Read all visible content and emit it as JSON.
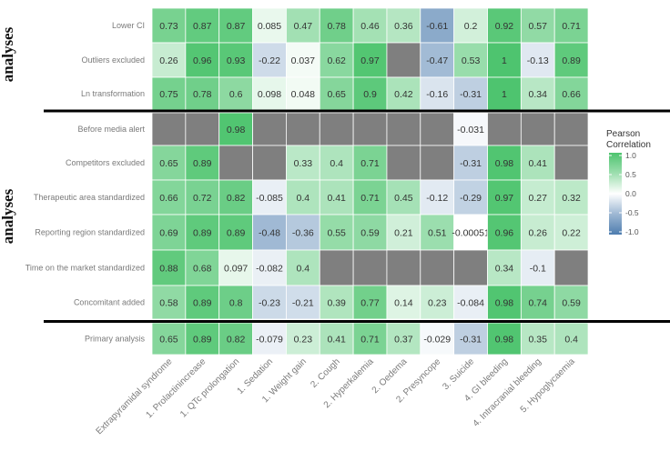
{
  "chart_data": {
    "type": "heatmap",
    "title": "",
    "xlabel": "",
    "ylabel": "",
    "group_labels": [
      "analyses",
      "analyses"
    ],
    "columns": [
      "Extrapyramidal syndrome",
      "1. Prolactinincrease",
      "1. QTc prolongation",
      "1. Sedation",
      "1. Weight gain",
      "2. Cough",
      "2. Hyperkalemia",
      "2. Oedema",
      "2. Presyncope",
      "3. Suicide",
      "4. GI bleeding",
      "4. Intracranial bleeding",
      "5. Hypoglycaemia"
    ],
    "rows": [
      {
        "label": "Lower CI",
        "group": 0,
        "values": [
          "0.73",
          "0.87",
          "0.87",
          "0.085",
          "0.47",
          "0.78",
          "0.46",
          "0.36",
          "-0.61",
          "0.2",
          "0.92",
          "0.57",
          "0.71"
        ]
      },
      {
        "label": "Outliers excluded",
        "group": 0,
        "values": [
          "0.26",
          "0.96",
          "0.93",
          "-0.22",
          "0.037",
          "0.62",
          "0.97",
          null,
          "-0.47",
          "0.53",
          "1",
          "-0.13",
          "0.89"
        ]
      },
      {
        "label": "Ln transformation",
        "group": 0,
        "values": [
          "0.75",
          "0.78",
          "0.6",
          "0.098",
          "0.048",
          "0.65",
          "0.9",
          "0.42",
          "-0.16",
          "-0.31",
          "1",
          "0.34",
          "0.66"
        ]
      },
      {
        "label": "Before media alert",
        "group": 1,
        "values": [
          null,
          null,
          "0.98",
          null,
          null,
          null,
          null,
          null,
          null,
          "-0.031",
          null,
          null,
          null
        ]
      },
      {
        "label": "Competitors excluded",
        "group": 1,
        "values": [
          "0.65",
          "0.89",
          null,
          null,
          "0.33",
          "0.4",
          "0.71",
          null,
          null,
          "-0.31",
          "0.98",
          "0.41",
          null
        ]
      },
      {
        "label": "Therapeutic area standardized",
        "group": 1,
        "values": [
          "0.66",
          "0.72",
          "0.82",
          "-0.085",
          "0.4",
          "0.41",
          "0.71",
          "0.45",
          "-0.12",
          "-0.29",
          "0.97",
          "0.27",
          "0.32"
        ]
      },
      {
        "label": "Reporting region standardized",
        "group": 1,
        "values": [
          "0.69",
          "0.89",
          "0.89",
          "-0.48",
          "-0.36",
          "0.55",
          "0.59",
          "0.21",
          "0.51",
          "-0.00051",
          "0.96",
          "0.26",
          "0.22"
        ]
      },
      {
        "label": "Time on the market standardized",
        "group": 1,
        "values": [
          "0.88",
          "0.68",
          "0.097",
          "-0.082",
          "0.4",
          null,
          null,
          null,
          null,
          null,
          "0.34",
          "-0.1",
          null
        ]
      },
      {
        "label": "Concomitant added",
        "group": 1,
        "values": [
          "0.58",
          "0.89",
          "0.8",
          "-0.23",
          "-0.21",
          "0.39",
          "0.77",
          "0.14",
          "0.23",
          "-0.084",
          "0.98",
          "0.74",
          "0.59"
        ]
      },
      {
        "label": "Primary analysis",
        "group": 2,
        "values": [
          "0.65",
          "0.89",
          "0.82",
          "-0.079",
          "0.23",
          "0.41",
          "0.71",
          "0.37",
          "-0.029",
          "-0.31",
          "0.98",
          "0.35",
          "0.4"
        ]
      }
    ],
    "legend": {
      "title_lines": [
        "Pearson",
        "Correlation"
      ],
      "ticks": [
        "1.0",
        "0.5",
        "0.0",
        "-0.5",
        "-1.0"
      ],
      "range": [
        -1,
        1
      ],
      "placement": "right"
    },
    "colors": {
      "high": "#3fbf62",
      "mid": "#ffffff",
      "low": "#3f72a8",
      "missing": "#7f7f7f",
      "separator": "#000000"
    }
  }
}
